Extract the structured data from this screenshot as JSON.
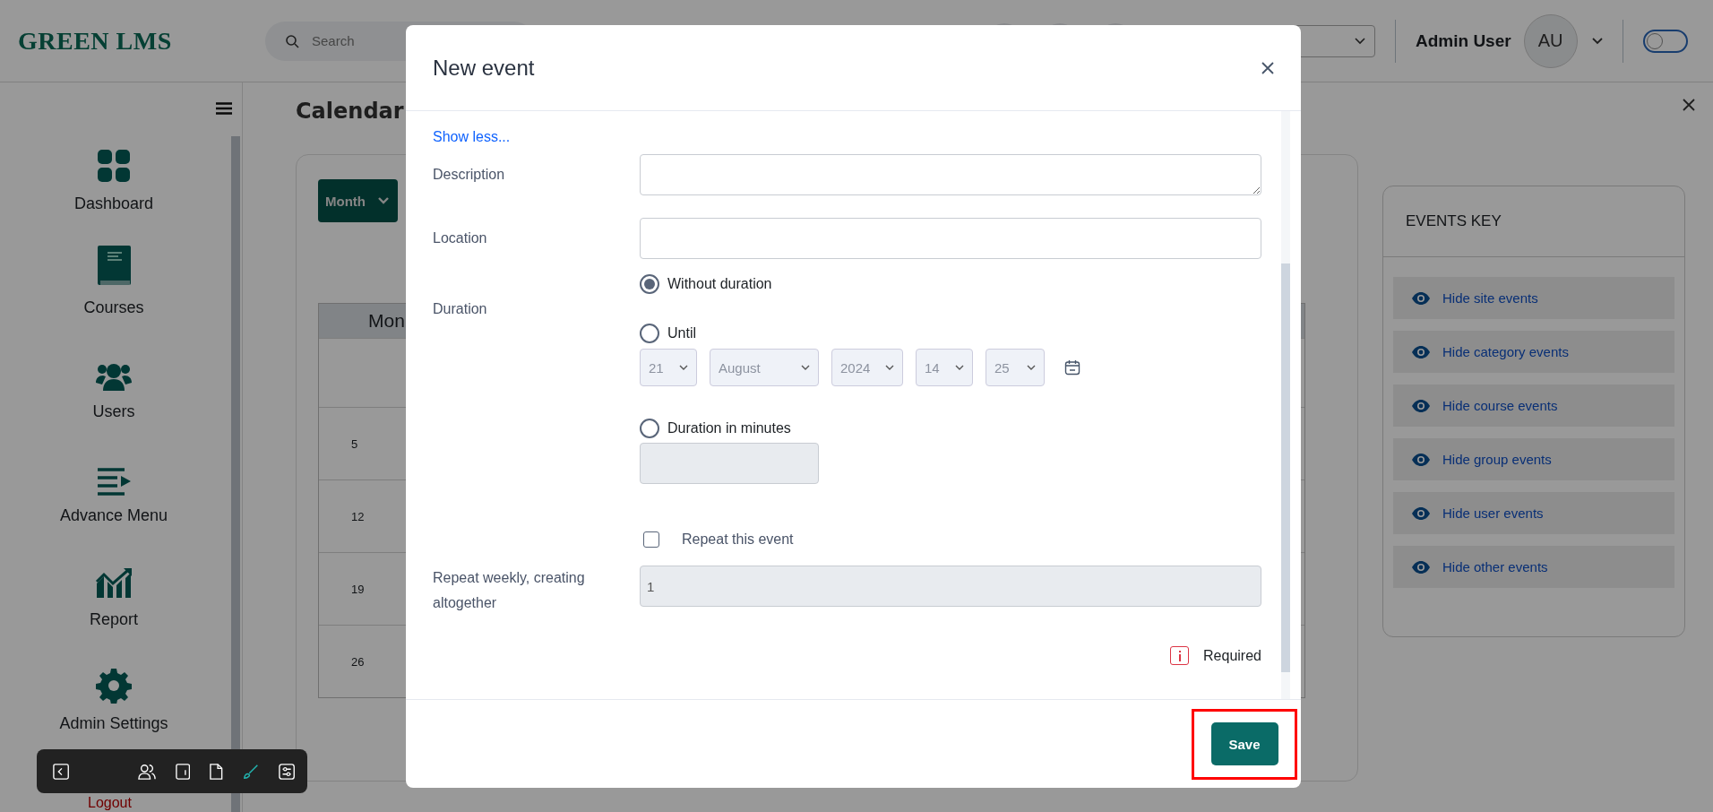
{
  "header": {
    "logo": "GREEN LMS",
    "search": {
      "placeholder": "Search"
    },
    "user_name": "Admin User",
    "avatar_initials": "AU",
    "theme_toggle": {
      "on": false
    }
  },
  "sidebar": {
    "items": [
      {
        "label": "Dashboard"
      },
      {
        "label": "Courses"
      },
      {
        "label": "Users"
      },
      {
        "label": "Advance Menu"
      },
      {
        "label": "Report"
      },
      {
        "label": "Admin Settings"
      }
    ],
    "logout": "Logout"
  },
  "page_title": "Calendar",
  "calendar": {
    "view_select": "Month",
    "column_header": "Mon",
    "week_days": [
      "5",
      "12",
      "19",
      "26"
    ]
  },
  "events_key": {
    "title": "EVENTS KEY",
    "items": [
      "Hide site events",
      "Hide category events",
      "Hide course events",
      "Hide group events",
      "Hide user events",
      "Hide other events"
    ]
  },
  "modal": {
    "title": "New event",
    "show_less": "Show less...",
    "description": {
      "label": "Description"
    },
    "location": {
      "label": "Location"
    },
    "duration": {
      "label": "Duration",
      "options": [
        {
          "label": "Without duration",
          "selected": true
        },
        {
          "label": "Until",
          "selected": false
        },
        {
          "label": "Duration in minutes",
          "selected": false
        }
      ],
      "until": {
        "disabled": true,
        "parts": [
          "21",
          "August",
          "2024",
          "14",
          "25"
        ]
      },
      "minutes_disabled": true
    },
    "repeat": {
      "label": "Repeat this event",
      "checked": false
    },
    "repeat_weekly": {
      "label": "Repeat weekly, creating altogether",
      "value": "1",
      "disabled": true
    },
    "required_note": "Required",
    "save": {
      "label": "Save",
      "highlighted": true
    }
  }
}
